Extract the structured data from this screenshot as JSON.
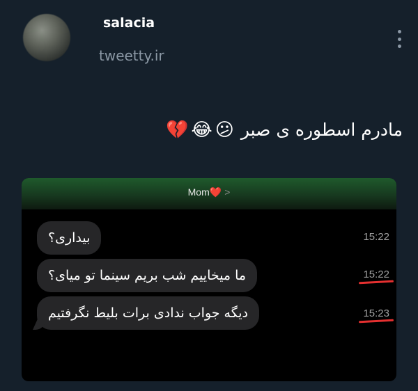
{
  "tweet": {
    "username": "salacia",
    "source": "tweetty.ir",
    "text": "مادرم اسطوره ی صبر",
    "emojis": [
      "😕",
      "😂",
      "💔"
    ]
  },
  "screenshot": {
    "contact_name": "Mom",
    "contact_heart": "❤️",
    "contact_chevron": ">",
    "messages": [
      {
        "text": "بیداری؟",
        "time": "15:22"
      },
      {
        "text": "ما میخاییم شب بریم سینما تو میای؟",
        "time": "15:22"
      },
      {
        "text": "دیگه جواب ندادی برات بلیط نگرفتیم",
        "time": "15:23"
      }
    ]
  }
}
